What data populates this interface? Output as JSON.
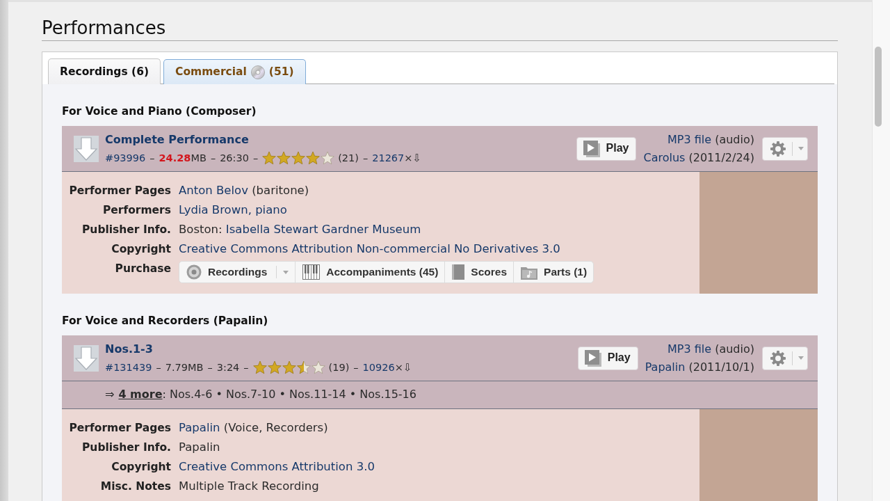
{
  "heading": "Performances",
  "tabs": [
    {
      "label": "Recordings (6)",
      "kind": "plain",
      "selected": true
    },
    {
      "label": "Commercial",
      "count": "(51)",
      "kind": "commercial",
      "selected": false
    }
  ],
  "sections": [
    {
      "title": "For Voice and Piano (Composer)",
      "recordings": [
        {
          "title": "Complete Performance",
          "meta": [
            {
              "kind": "link",
              "text": "#93996"
            },
            {
              "kind": "sep",
              "text": "–"
            },
            {
              "kind": "size",
              "value": "24.28",
              "unit": "MB",
              "large": true
            },
            {
              "kind": "sep",
              "text": "–"
            },
            {
              "kind": "text",
              "text": "26:30"
            },
            {
              "kind": "sep",
              "text": "–"
            },
            {
              "kind": "stars",
              "stars": 4
            },
            {
              "kind": "text",
              "text": "(21)"
            },
            {
              "kind": "sep",
              "text": "–"
            },
            {
              "kind": "link",
              "text": "21267"
            },
            {
              "kind": "text",
              "text": "×⇩"
            }
          ],
          "play": "Play",
          "file": [
            {
              "kind": "link",
              "text": "MP3 file"
            },
            {
              "kind": "text",
              "text": "(audio)"
            }
          ],
          "uploader": [
            {
              "kind": "link",
              "text": "Carolus"
            },
            {
              "kind": "text",
              "text": "(2011/2/24)"
            }
          ],
          "details": [
            {
              "kind": "info",
              "label": "Performer Pages",
              "value": [
                {
                  "kind": "link",
                  "text": "Anton Belov"
                },
                {
                  "kind": "text",
                  "text": "(baritone)"
                }
              ]
            },
            {
              "kind": "info",
              "label": "Performers",
              "value": [
                {
                  "kind": "link",
                  "text": "Lydia Brown, piano"
                }
              ]
            },
            {
              "kind": "info",
              "label": "Publisher Info.",
              "value": [
                {
                  "kind": "text",
                  "text": "Boston:"
                },
                {
                  "kind": "link",
                  "text": "Isabella Stewart Gardner Museum"
                }
              ]
            },
            {
              "kind": "info",
              "label": "Copyright",
              "value": [
                {
                  "kind": "link",
                  "text": "Creative Commons Attribution Non-commercial No Derivatives 3.0"
                }
              ]
            },
            {
              "kind": "purchase",
              "label": "Purchase",
              "buttons": [
                {
                  "kind": "recordings",
                  "label": "Recordings",
                  "dropdown": true
                },
                {
                  "kind": "accompaniments",
                  "label": "Accompaniments (45)",
                  "dropdown": false
                },
                {
                  "kind": "scores",
                  "label": "Scores",
                  "dropdown": false
                },
                {
                  "kind": "parts",
                  "label": "Parts (1)",
                  "dropdown": false
                }
              ]
            }
          ]
        }
      ]
    },
    {
      "title": "For Voice and Recorders (Papalin)",
      "recordings": [
        {
          "title": "Nos.1-3",
          "meta": [
            {
              "kind": "link",
              "text": "#131439"
            },
            {
              "kind": "sep",
              "text": "–"
            },
            {
              "kind": "size",
              "value": "7.79",
              "unit": "MB",
              "large": false
            },
            {
              "kind": "sep",
              "text": "–"
            },
            {
              "kind": "text",
              "text": "3:24"
            },
            {
              "kind": "sep",
              "text": "–"
            },
            {
              "kind": "stars",
              "stars": 3.5
            },
            {
              "kind": "text",
              "text": "(19)"
            },
            {
              "kind": "sep",
              "text": "–"
            },
            {
              "kind": "link",
              "text": "10926"
            },
            {
              "kind": "text",
              "text": "×⇩"
            }
          ],
          "play": "Play",
          "file": [
            {
              "kind": "link",
              "text": "MP3 file"
            },
            {
              "kind": "text",
              "text": "(audio)"
            }
          ],
          "uploader": [
            {
              "kind": "link",
              "text": "Papalin"
            },
            {
              "kind": "text",
              "text": "(2011/10/1)"
            }
          ],
          "more": {
            "arrow": "⇒",
            "link": "4 more",
            "rest": ": Nos.4-6 • Nos.7-10 • Nos.11-14 • Nos.15-16"
          },
          "details": [
            {
              "kind": "info",
              "label": "Performer Pages",
              "value": [
                {
                  "kind": "link",
                  "text": "Papalin"
                },
                {
                  "kind": "text",
                  "text": "(Voice, Recorders)"
                }
              ]
            },
            {
              "kind": "info",
              "label": "Publisher Info.",
              "value": [
                {
                  "kind": "text",
                  "text": "Papalin"
                }
              ]
            },
            {
              "kind": "info",
              "label": "Copyright",
              "value": [
                {
                  "kind": "link",
                  "text": "Creative Commons Attribution 3.0"
                }
              ]
            },
            {
              "kind": "info",
              "label": "Misc. Notes",
              "value": [
                {
                  "kind": "text",
                  "text": "Multiple Track Recording"
                }
              ]
            }
          ]
        }
      ]
    }
  ]
}
